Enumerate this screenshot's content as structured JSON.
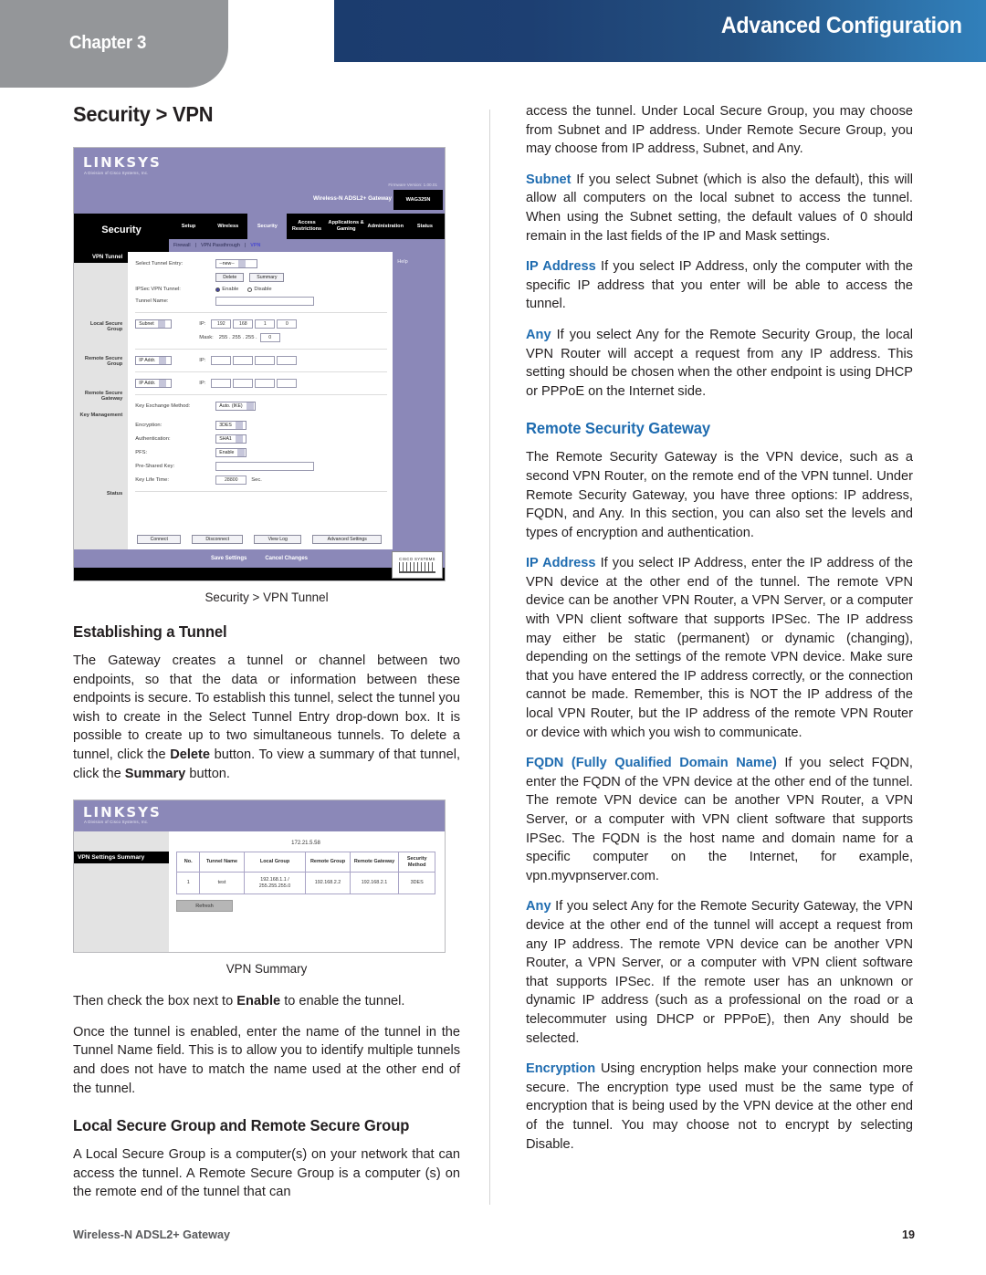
{
  "header": {
    "chapter_label": "Chapter 3",
    "banner_title": "Advanced Configuration"
  },
  "footer": {
    "product": "Wireless-N ADSL2+ Gateway",
    "page_number": "19"
  },
  "left_column": {
    "section_title": "Security > VPN",
    "figure1_caption": "Security > VPN Tunnel",
    "heading_establishing": "Establishing a Tunnel",
    "para_establishing": "The Gateway creates a tunnel or channel between two endpoints, so that the data or information between these endpoints is secure.  To establish this tunnel, select the tunnel you wish to create in the Select Tunnel Entry drop-down box.  It is possible to create up to two simultaneous tunnels. To delete a tunnel, click the ",
    "para_establishing_b1": "Delete",
    "para_establishing_mid": " button. To view a summary of that tunnel, click the ",
    "para_establishing_b2": "Summary",
    "para_establishing_end": " button.",
    "figure2_caption": "VPN Summary",
    "para_enable_a": "Then check the box next to ",
    "para_enable_b": "Enable",
    "para_enable_c": " to enable the tunnel.",
    "para_tunnelname": "Once the tunnel is enabled, enter the name of the tunnel in the Tunnel Name field.  This is to allow you to identify multiple tunnels and does not have to match the name used at the other end of the tunnel.",
    "heading_local_remote": "Local Secure Group and Remote Secure Group",
    "para_local_remote": "A Local Secure Group is a computer(s) on your network that can access the tunnel. A Remote Secure Group is a computer (s) on the remote end of the tunnel that can"
  },
  "right_column": {
    "para_continued": "access the tunnel. Under Local Secure Group, you may choose from Subnet and IP address. Under Remote Secure Group, you may choose from IP address, Subnet, and Any.",
    "subnet_lead": "Subnet",
    "subnet_text": " If you select Subnet (which is also the default), this will allow all computers on the local subnet to access the tunnel. When using the Subnet setting, the default values of 0 should remain in the last fields of the IP and Mask settings.",
    "ipaddr_lead": "IP Address",
    "ipaddr_text": " If you select IP Address, only the computer with the specific IP address that you enter will be able to access the tunnel.",
    "any_lead": "Any",
    "any_text": " If you select Any for the Remote Security Group, the local VPN Router will accept a request from any IP address. This setting should be chosen when the other endpoint is using DHCP or PPPoE on the Internet side.",
    "heading_rsg": "Remote Security Gateway",
    "para_rsg": "The Remote Security Gateway is the VPN device, such as a second VPN Router, on the remote end of the VPN tunnel. Under Remote Security Gateway, you have three options: IP address, FQDN, and Any. In this section, you can also set the levels and types of encryption and authentication.",
    "ipaddr2_lead": "IP Address",
    "ipaddr2_text": "  If you select IP Address, enter the IP address of the VPN device at the other end of the tunnel. The remote VPN device can be another VPN Router, a VPN Server, or a computer with VPN client software that supports IPSec. The IP address may either be static (permanent) or dynamic (changing), depending on the settings of the remote VPN device.  Make sure that you have entered the IP address correctly, or the connection cannot be made.  Remember, this is NOT the IP address of the local VPN Router, but the IP address of the remote VPN Router or device with which you wish to communicate.",
    "fqdn_lead": "FQDN (Fully Qualified Domain Name)",
    "fqdn_text": " If you select FQDN, enter the FQDN of the VPN device at the other end of the tunnel. The remote VPN device can be another VPN Router, a VPN Server, or a computer with VPN client software that supports IPSec.  The FQDN is the host name and domain name for a specific computer on the Internet, for example, vpn.myvpnserver.com.",
    "any2_lead": "Any",
    "any2_text": " If you select Any for the Remote Security Gateway, the VPN device at the other end of the tunnel will accept a request from any IP address. The remote VPN device can be another VPN Router, a VPN Server, or a computer with VPN client software that supports IPSec. If the remote user has an unknown or dynamic IP address (such as a professional on the road or a telecommuter using DHCP or PPPoE), then Any should be selected.",
    "encryption_lead": "Encryption",
    "encryption_text": "  Using encryption helps make your connection more secure. The encryption type used must be the same type of encryption that is being used by the VPN device at the other end of the tunnel. You may choose not to encrypt by selecting Disable."
  },
  "figure1_router_ui": {
    "brand": "LINKSYS",
    "brand_sub": "A Division of Cisco Systems, Inc.",
    "firmware": "Firmware Version: 1.00.01",
    "model_name": "Wireless-N ADSL2+ Gateway",
    "model_badge": "WAG325N",
    "section_label": "Security",
    "tabs": [
      "Setup",
      "Wireless",
      "Security",
      "Access Restrictions",
      "Applications & Gaming",
      "Administration",
      "Status"
    ],
    "active_tab": "Security",
    "subtabs": [
      "Firewall",
      "VPN Passthrough",
      "VPN"
    ],
    "active_subtab": "VPN",
    "sidebar": [
      "VPN Tunnel",
      "Local Secure Group",
      "Remote Secure Group",
      "Remote Secure Gateway",
      "Key Management",
      "Status"
    ],
    "help_label": "Help",
    "fields": {
      "select_tunnel_entry_label": "Select Tunnel Entry:",
      "select_tunnel_entry_value": "--new--",
      "delete_button": "Delete",
      "summary_button": "Summary",
      "ipsec_vpn_tunnel_label": "IPSec VPN Tunnel:",
      "enable_label": "Enable",
      "disable_label": "Disable",
      "tunnel_name_label": "Tunnel Name:",
      "tunnel_name_value": "",
      "local_group_type": "Subnet",
      "local_ip_label": "IP:",
      "local_ip": [
        "192",
        "168",
        "1",
        "0"
      ],
      "mask_label": "Mask:",
      "mask_prefix": "255 . 255 . 255 .",
      "mask_last": "0",
      "remote_group_type": "IP Addr.",
      "remote_ip_label": "IP:",
      "remote_gateway_type": "IP Addr.",
      "remote_gateway_ip_label": "IP:",
      "key_exchange_label": "Key Exchange Method:",
      "key_exchange_value": "Auto. (IKE)",
      "encryption_label": "Encryption:",
      "encryption_value": "3DES",
      "authentication_label": "Authentication:",
      "authentication_value": "SHA1",
      "pfs_label": "PFS:",
      "pfs_value": "Enable",
      "preshared_key_label": "Pre-Shared Key:",
      "preshared_key_value": "",
      "key_lifetime_label": "Key Life Time:",
      "key_lifetime_value": "28800",
      "key_lifetime_unit": "Sec."
    },
    "action_buttons": [
      "Connect",
      "Disconnect",
      "View Log",
      "Advanced Settings"
    ],
    "bottom_buttons": [
      "Save Settings",
      "Cancel Changes"
    ],
    "cisco_badge": "CISCO SYSTEMS"
  },
  "figure2_vpn_summary": {
    "brand": "LINKSYS",
    "brand_sub": "A Division of Cisco Systems, Inc.",
    "panel_title": "VPN Settings Summary",
    "ip_address": "172.21.5.58",
    "columns": [
      "No.",
      "Tunnel Name",
      "Local Group",
      "Remote Group",
      "Remote Gateway",
      "Security Method"
    ],
    "rows": [
      [
        "1",
        "test",
        "192.168.1.1 / 255.255.255.0",
        "192.168.2.2",
        "192.168.2.1",
        "3DES"
      ]
    ],
    "refresh_button": "Refresh"
  }
}
